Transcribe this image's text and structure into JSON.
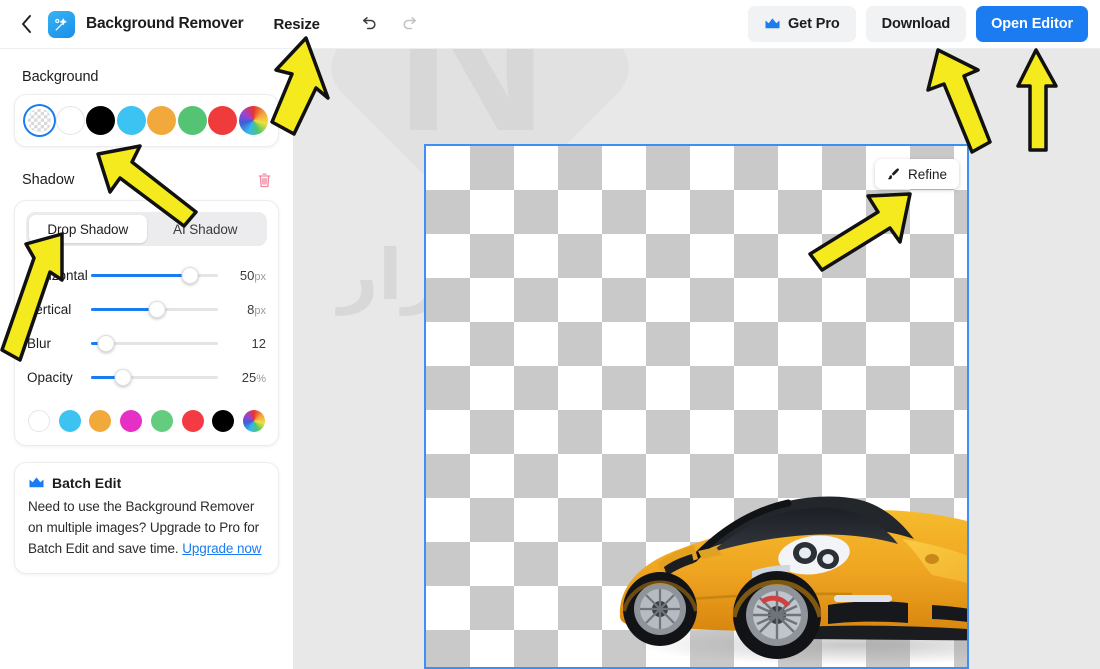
{
  "header": {
    "back_icon": "chevron-left-icon",
    "logo_icon": "magic-wand-icon",
    "title": "Background Remover",
    "resize_label": "Resize",
    "undo_icon": "undo-icon",
    "redo_icon": "redo-icon",
    "get_pro_label": "Get Pro",
    "get_pro_icon": "crown-icon",
    "download_label": "Download",
    "open_editor_label": "Open Editor"
  },
  "sidebar": {
    "background": {
      "label": "Background",
      "swatches": [
        {
          "name": "transparent",
          "color": "transparent",
          "selected": true
        },
        {
          "name": "white",
          "color": "#ffffff",
          "selected": false
        },
        {
          "name": "black",
          "color": "#000000",
          "selected": false
        },
        {
          "name": "sky-blue",
          "color": "#3cc3f2",
          "selected": false
        },
        {
          "name": "orange",
          "color": "#f2a93b",
          "selected": false
        },
        {
          "name": "green",
          "color": "#54c474",
          "selected": false
        },
        {
          "name": "red",
          "color": "#ef3b3b",
          "selected": false
        },
        {
          "name": "color-wheel",
          "color": "wheel",
          "selected": false
        }
      ]
    },
    "shadow": {
      "label": "Shadow",
      "delete_icon": "trash-icon",
      "tabs": [
        {
          "label": "Drop Shadow",
          "active": true
        },
        {
          "label": "AI Shadow",
          "active": false
        }
      ],
      "sliders": [
        {
          "label": "Horizontal",
          "value": "50",
          "unit": "px",
          "fill_percent": 78
        },
        {
          "label": "Vertical",
          "value": "8",
          "unit": "px",
          "fill_percent": 52
        },
        {
          "label": "Blur",
          "value": "12",
          "unit": "",
          "fill_percent": 12
        },
        {
          "label": "Opacity",
          "value": "25",
          "unit": "%",
          "fill_percent": 25
        }
      ],
      "colors": [
        {
          "name": "white",
          "color": "#ffffff"
        },
        {
          "name": "sky-blue",
          "color": "#3cc3f2"
        },
        {
          "name": "orange",
          "color": "#f2a93b"
        },
        {
          "name": "magenta",
          "color": "#e62fc4"
        },
        {
          "name": "green",
          "color": "#63cc7f"
        },
        {
          "name": "red",
          "color": "#f43b44"
        },
        {
          "name": "black",
          "color": "#000000"
        },
        {
          "name": "color-wheel",
          "color": "wheel"
        }
      ]
    },
    "batch_edit": {
      "icon": "crown-icon",
      "title": "Batch Edit",
      "text": "Need to use the Background Remover on multiple images? Upgrade to Pro for Batch Edit and save time.",
      "link_label": "Upgrade now"
    }
  },
  "canvas": {
    "refine_label": "Refine",
    "refine_icon": "brush-icon",
    "selection_color": "#3d8ef5",
    "image_alt": "yellow-sports-car",
    "watermark_letter": "N"
  },
  "annotations": {
    "arrow_color": "#f5ea1e",
    "arrows": [
      {
        "name": "arrow-to-resize"
      },
      {
        "name": "arrow-to-background-swatches"
      },
      {
        "name": "arrow-to-shadow-sliders"
      },
      {
        "name": "arrow-to-refine"
      },
      {
        "name": "arrow-to-download"
      },
      {
        "name": "arrow-to-open-editor"
      }
    ]
  }
}
